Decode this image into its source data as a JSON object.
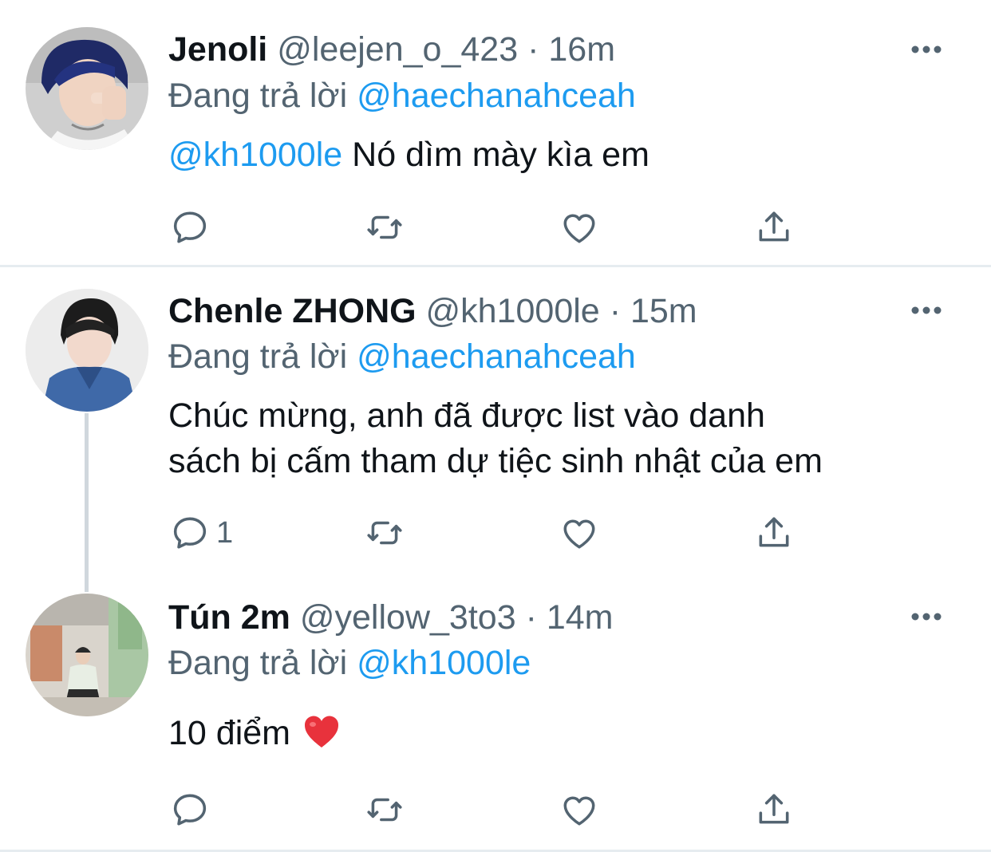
{
  "tweets": [
    {
      "name": "Jenoli",
      "handle": "@leejen_o_423",
      "separator": "·",
      "time": "16m",
      "replying_prefix": "Đang trả lời",
      "replying_to": "@haechanahceah",
      "mention": "@kh1000le",
      "text": " Nó dìm mày kìa em",
      "reply_count": ""
    },
    {
      "name": "Chenle ZHONG",
      "handle": "@kh1000le",
      "separator": "·",
      "time": "15m",
      "replying_prefix": "Đang trả lời",
      "replying_to": "@haechanahceah",
      "text_line1": "Chúc mừng, anh đã được list vào danh",
      "text_line2": "sách bị cấm tham dự tiệc sinh nhật của em",
      "reply_count": "1"
    },
    {
      "name": "Tún 2m",
      "handle": "@yellow_3to3",
      "separator": "·",
      "time": "14m",
      "replying_prefix": "Đang trả lời",
      "replying_to": "@kh1000le",
      "text": "10 điểm",
      "reply_count": ""
    }
  ],
  "icons": {
    "reply": "reply-icon",
    "retweet": "retweet-icon",
    "like": "heart-icon",
    "share": "share-icon",
    "more": "more-icon"
  },
  "colors": {
    "accent": "#1d9bf0",
    "secondary_text": "#536471",
    "primary_text": "#0f1419",
    "divider": "#e6ecf0",
    "thread_line": "#d0d7dd"
  }
}
